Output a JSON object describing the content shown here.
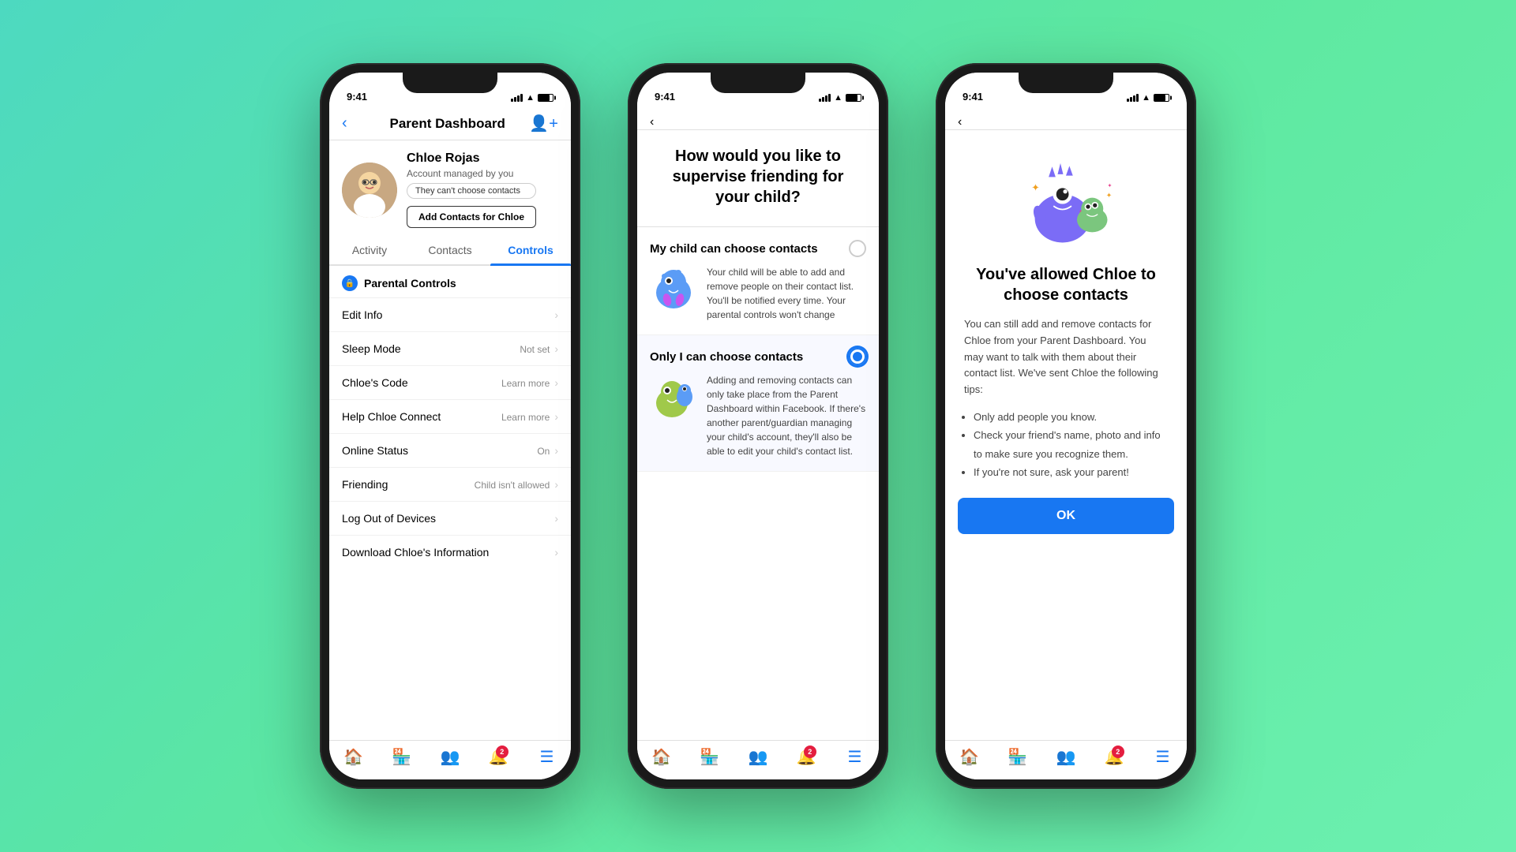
{
  "background": "#5de8a0",
  "phone1": {
    "status_time": "9:41",
    "nav_title": "Parent Dashboard",
    "profile_name": "Chloe Rojas",
    "profile_sub": "Account managed by you",
    "profile_tag": "They can't choose contacts",
    "add_contacts_btn": "Add Contacts for Chloe",
    "tabs": [
      "Activity",
      "Contacts",
      "Controls"
    ],
    "active_tab": "Controls",
    "menu_header": "Parental Controls",
    "menu_items": [
      {
        "label": "Edit Info",
        "value": ""
      },
      {
        "label": "Sleep Mode",
        "value": "Not set"
      },
      {
        "label": "Chloe's Code",
        "value": "Learn more"
      },
      {
        "label": "Help Chloe Connect",
        "value": "Learn more"
      },
      {
        "label": "Online Status",
        "value": "On"
      },
      {
        "label": "Friending",
        "value": "Child isn't allowed"
      },
      {
        "label": "Log Out of Devices",
        "value": ""
      },
      {
        "label": "Download Chloe's Information",
        "value": ""
      }
    ],
    "bottom_nav": [
      "🏠",
      "🏪",
      "👥",
      "🔔",
      "☰"
    ],
    "badge_count": "2",
    "active_nav": 4
  },
  "phone2": {
    "status_time": "9:41",
    "question": "How would you like to supervise friending for your child?",
    "options": [
      {
        "title": "My child can choose contacts",
        "selected": false,
        "description": "Your child will be able to add and remove people on their contact list. You'll be notified every time. Your parental controls won't change"
      },
      {
        "title": "Only I can choose contacts",
        "selected": true,
        "description": "Adding and removing contacts can only take place from the Parent Dashboard within Facebook. If there's another parent/guardian managing your child's account, they'll also be able to edit your child's contact list."
      }
    ]
  },
  "phone3": {
    "status_time": "9:41",
    "title": "You've allowed Chloe to choose contacts",
    "body": "You can still add and remove contacts for Chloe from your Parent Dashboard. You may want to talk with them about their contact list. We've sent Chloe the following tips:",
    "bullets": [
      "Only add people you know.",
      "Check your friend's name, photo and info to make sure you recognize them.",
      "If you're not sure, ask your parent!"
    ],
    "ok_label": "OK"
  }
}
